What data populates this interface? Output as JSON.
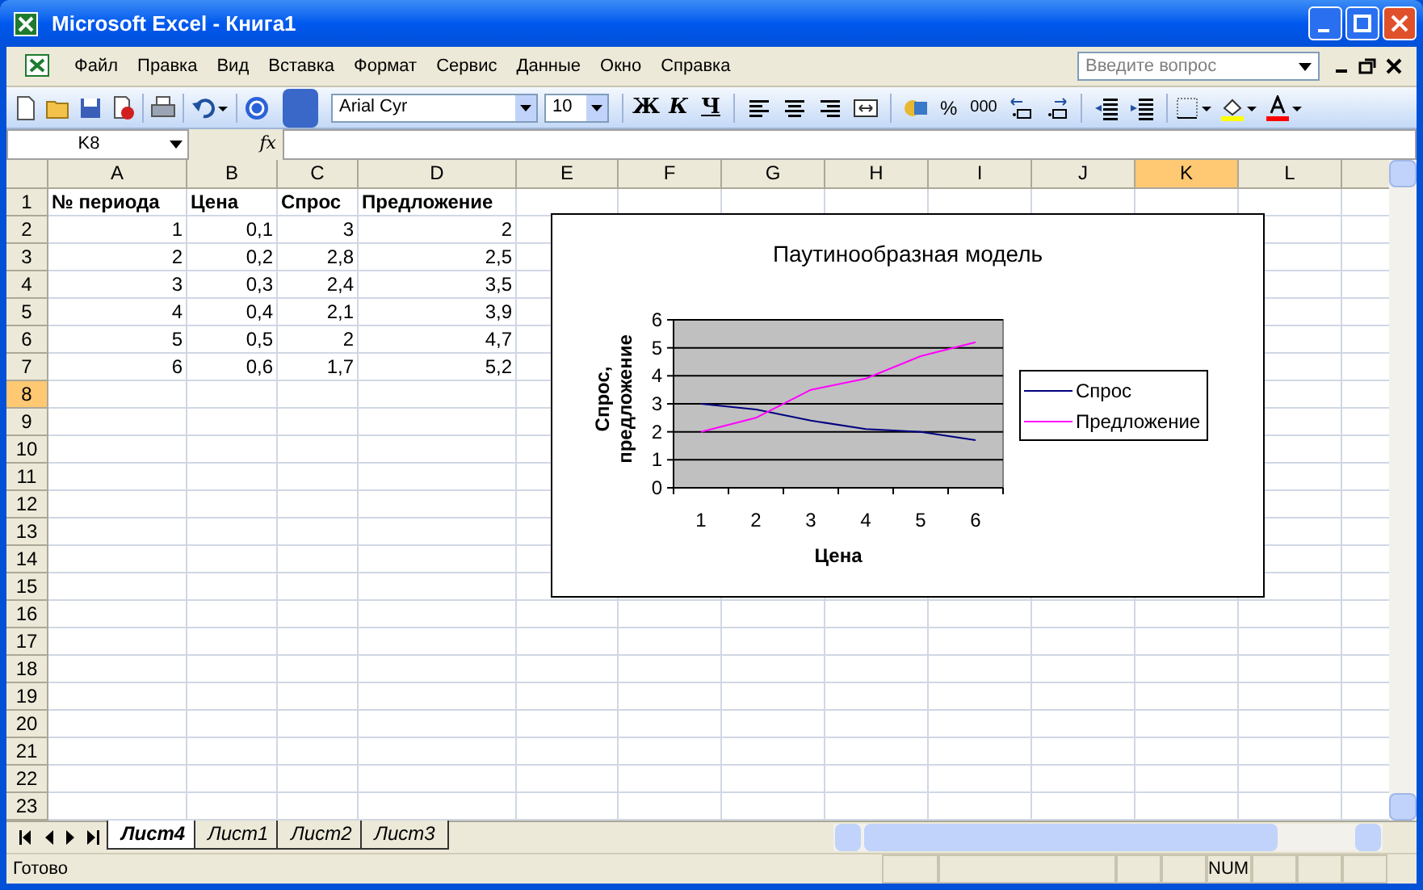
{
  "window": {
    "title": "Microsoft Excel - Книга1"
  },
  "menu": [
    "Файл",
    "Правка",
    "Вид",
    "Вставка",
    "Формат",
    "Сервис",
    "Данные",
    "Окно",
    "Справка"
  ],
  "help_search": {
    "placeholder": "Введите вопрос"
  },
  "toolbar": {
    "font": "Arial Cyr",
    "size": "10",
    "bold": "Ж",
    "italic": "К",
    "underline": "Ч",
    "percent": "%",
    "thousands": "000"
  },
  "formula_bar": {
    "name_box": "K8",
    "fx": "fx"
  },
  "columns": [
    {
      "label": "A",
      "selected": false
    },
    {
      "label": "B",
      "selected": false
    },
    {
      "label": "C",
      "selected": false
    },
    {
      "label": "D",
      "selected": false
    },
    {
      "label": "E",
      "selected": false
    },
    {
      "label": "F",
      "selected": false
    },
    {
      "label": "G",
      "selected": false
    },
    {
      "label": "H",
      "selected": false
    },
    {
      "label": "I",
      "selected": false
    },
    {
      "label": "J",
      "selected": false
    },
    {
      "label": "K",
      "selected": true
    },
    {
      "label": "L",
      "selected": false
    }
  ],
  "rows": [
    {
      "label": "1",
      "selected": false,
      "kind": "header",
      "cells": [
        "№ периода",
        "Цена",
        "Спрос",
        "Предложение"
      ]
    },
    {
      "label": "2",
      "selected": false,
      "kind": "data",
      "cells": [
        "1",
        "0,1",
        "3",
        "2"
      ]
    },
    {
      "label": "3",
      "selected": false,
      "kind": "data",
      "cells": [
        "2",
        "0,2",
        "2,8",
        "2,5"
      ]
    },
    {
      "label": "4",
      "selected": false,
      "kind": "data",
      "cells": [
        "3",
        "0,3",
        "2,4",
        "3,5"
      ]
    },
    {
      "label": "5",
      "selected": false,
      "kind": "data",
      "cells": [
        "4",
        "0,4",
        "2,1",
        "3,9"
      ]
    },
    {
      "label": "6",
      "selected": false,
      "kind": "data",
      "cells": [
        "5",
        "0,5",
        "2",
        "4,7"
      ]
    },
    {
      "label": "7",
      "selected": false,
      "kind": "data",
      "cells": [
        "6",
        "0,6",
        "1,7",
        "5,2"
      ]
    },
    {
      "label": "8",
      "selected": true
    },
    {
      "label": "9",
      "selected": false
    },
    {
      "label": "10",
      "selected": false
    },
    {
      "label": "11",
      "selected": false
    },
    {
      "label": "12",
      "selected": false
    },
    {
      "label": "13",
      "selected": false
    },
    {
      "label": "14",
      "selected": false
    },
    {
      "label": "15",
      "selected": false
    },
    {
      "label": "16",
      "selected": false
    },
    {
      "label": "17",
      "selected": false
    },
    {
      "label": "18",
      "selected": false
    },
    {
      "label": "19",
      "selected": false
    },
    {
      "label": "20",
      "selected": false
    },
    {
      "label": "21",
      "selected": false
    },
    {
      "label": "22",
      "selected": false
    },
    {
      "label": "23",
      "selected": false
    }
  ],
  "chart": {
    "chart_data": {
      "type": "line",
      "title": "Паутинообразная модель",
      "xlabel": "Цена",
      "ylabel": "Спрос, предложение",
      "categories": [
        "1",
        "2",
        "3",
        "4",
        "5",
        "6"
      ],
      "series": [
        {
          "name": "Спрос",
          "color": "#000080",
          "values": [
            3,
            2.8,
            2.4,
            2.1,
            2,
            1.7
          ]
        },
        {
          "name": "Предложение",
          "color": "#ff00ff",
          "values": [
            2,
            2.5,
            3.5,
            3.9,
            4.7,
            5.2
          ]
        }
      ],
      "ylim": [
        0,
        6
      ],
      "yticks": [
        0,
        1,
        2,
        3,
        4,
        5,
        6
      ],
      "grid": true,
      "legend": "right"
    }
  },
  "sheet_tabs": [
    {
      "label": "Лист4",
      "selected": true
    },
    {
      "label": "Лист1",
      "selected": false
    },
    {
      "label": "Лист2",
      "selected": false
    },
    {
      "label": "Лист3",
      "selected": false
    }
  ],
  "status_bar": {
    "status": "Готово",
    "num": "NUM"
  }
}
